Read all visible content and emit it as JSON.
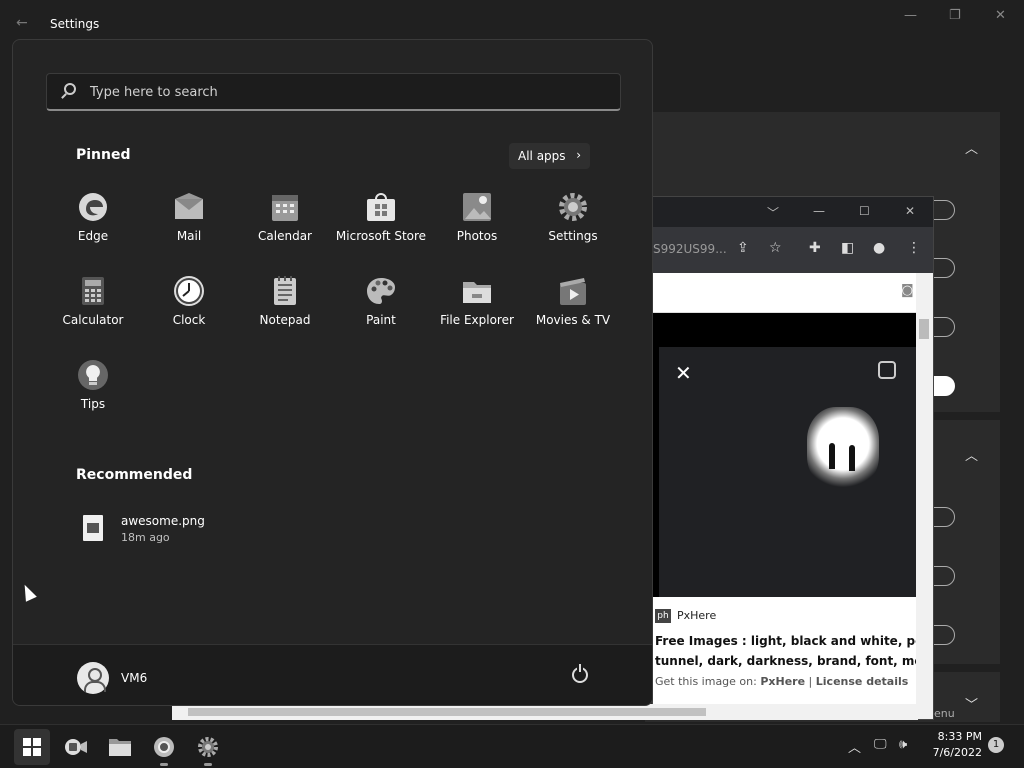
{
  "settings_window": {
    "title": "Settings",
    "back_glyph": "←",
    "minimize_glyph": "—",
    "maximize_glyph": "❐",
    "close_glyph": "✕"
  },
  "browser": {
    "url_fragment": "S992US99...",
    "source_name": "PxHere",
    "source_logo": "ph",
    "result_title_line1": "Free Images : light, black and white, peo",
    "result_title_line2": "tunnel, dark, darkness, brand, font, mer",
    "get_image_prefix": "Get this image on: ",
    "get_image_link": "PxHere",
    "license_link": "License details",
    "menu_fragment": "enu"
  },
  "start_menu": {
    "search_placeholder": "Type here to search",
    "pinned_title": "Pinned",
    "all_apps_label": "All apps",
    "all_apps_arrow": "›",
    "pinned_apps": [
      {
        "label": "Edge",
        "icon": "edge-icon"
      },
      {
        "label": "Mail",
        "icon": "mail-icon"
      },
      {
        "label": "Calendar",
        "icon": "calendar-icon"
      },
      {
        "label": "Microsoft Store",
        "icon": "store-icon"
      },
      {
        "label": "Photos",
        "icon": "photos-icon"
      },
      {
        "label": "Settings",
        "icon": "gear-icon"
      },
      {
        "label": "Calculator",
        "icon": "calculator-icon"
      },
      {
        "label": "Clock",
        "icon": "clock-icon"
      },
      {
        "label": "Notepad",
        "icon": "notepad-icon"
      },
      {
        "label": "Paint",
        "icon": "paint-icon"
      },
      {
        "label": "File Explorer",
        "icon": "folder-icon"
      },
      {
        "label": "Movies & TV",
        "icon": "movies-icon"
      },
      {
        "label": "Tips",
        "icon": "lightbulb-icon"
      }
    ],
    "recommended_title": "Recommended",
    "recommended": [
      {
        "name": "awesome.png",
        "time": "18m ago"
      }
    ],
    "user_name": "VM6"
  },
  "taskbar": {
    "time": "8:33 PM",
    "date": "7/6/2022",
    "notification_count": "1",
    "chevron_glyph": "︿"
  }
}
